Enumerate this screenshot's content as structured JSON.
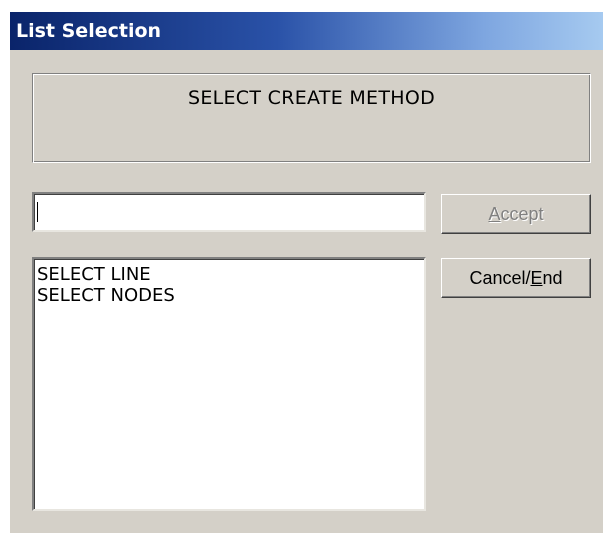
{
  "window": {
    "title": "List Selection"
  },
  "message": {
    "text": "SELECT CREATE METHOD"
  },
  "input": {
    "value": ""
  },
  "list": {
    "items": [
      "SELECT LINE",
      "SELECT NODES"
    ]
  },
  "buttons": {
    "accept": {
      "label_mnemonic": "A",
      "label_rest": "ccept",
      "enabled": false
    },
    "cancel": {
      "label_before": "Cancel/",
      "label_mnemonic": "E",
      "label_rest": "nd",
      "enabled": true
    }
  },
  "colors": {
    "dialog_face": "#d4d0c8",
    "titlebar_start": "#0a246a",
    "titlebar_end": "#a6caf0",
    "disabled_text": "#808080"
  }
}
